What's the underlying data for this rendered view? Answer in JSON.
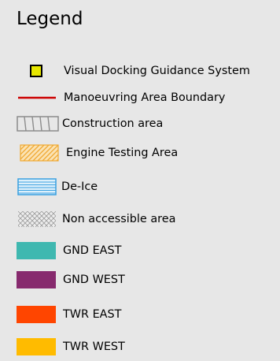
{
  "legend": {
    "title": "Legend",
    "items": [
      {
        "label": "Visual Docking Guidance System",
        "symbol": "yellow-square-icon",
        "color": "#e6e600"
      },
      {
        "label": "Manoeuvring Area Boundary",
        "symbol": "red-line-icon",
        "color": "#cc0000"
      },
      {
        "label": "Construction area",
        "symbol": "construction-hatch-icon",
        "color": "#8c8c8c"
      },
      {
        "label": "Engine Testing Area",
        "symbol": "orange-hatch-icon",
        "color": "#f0a830"
      },
      {
        "label": "De-Ice",
        "symbol": "blue-stripes-icon",
        "color": "#3aa0e0"
      },
      {
        "label": "Non accessible area",
        "symbol": "crosshatch-icon",
        "color": "#a0a0a0"
      },
      {
        "label": "GND EAST",
        "symbol": "teal-swatch-icon",
        "color": "#3fb8b0"
      },
      {
        "label": "GND WEST",
        "symbol": "purple-swatch-icon",
        "color": "#872a6e"
      },
      {
        "label": "TWR EAST",
        "symbol": "red-orange-swatch-icon",
        "color": "#ff4500"
      },
      {
        "label": "TWR WEST",
        "symbol": "amber-swatch-icon",
        "color": "#ffbb00"
      }
    ]
  }
}
